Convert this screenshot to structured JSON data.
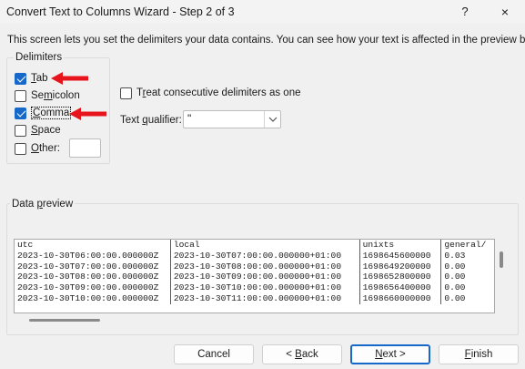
{
  "window": {
    "title": "Convert Text to Columns Wizard - Step 2 of 3",
    "help_label": "?",
    "close_label": "×"
  },
  "instructions": "This screen lets you set the delimiters your data contains.  You can see how your text is affected in the preview below.",
  "delimiters": {
    "legend": "Delimiters",
    "tab": {
      "pre": "",
      "key": "T",
      "post": "ab",
      "checked": true
    },
    "semicolon": {
      "pre": "Se",
      "key": "m",
      "post": "icolon",
      "checked": false
    },
    "comma": {
      "pre": "",
      "key": "C",
      "post": "omma",
      "checked": true
    },
    "space": {
      "pre": "",
      "key": "S",
      "post": "pace",
      "checked": false
    },
    "other": {
      "pre": "",
      "key": "O",
      "post": "ther:",
      "checked": false,
      "value": ""
    }
  },
  "consecutive": {
    "pre": "T",
    "key": "r",
    "post": "eat consecutive delimiters as one",
    "checked": false
  },
  "text_qualifier": {
    "pre": "Text ",
    "key": "q",
    "post": "ualifier:",
    "value": "\""
  },
  "preview": {
    "legend_pre": "Data ",
    "legend_key": "p",
    "legend_post": "review",
    "rows": [
      [
        "utc",
        "local",
        "unixts",
        "general/"
      ],
      [
        "2023-10-30T06:00:00.000000Z",
        "2023-10-30T07:00:00.000000+01:00",
        "1698645600000",
        "0.03"
      ],
      [
        "2023-10-30T07:00:00.000000Z",
        "2023-10-30T08:00:00.000000+01:00",
        "1698649200000",
        "0.00"
      ],
      [
        "2023-10-30T08:00:00.000000Z",
        "2023-10-30T09:00:00.000000+01:00",
        "1698652800000",
        "0.00"
      ],
      [
        "2023-10-30T09:00:00.000000Z",
        "2023-10-30T10:00:00.000000+01:00",
        "1698656400000",
        "0.00"
      ],
      [
        "2023-10-30T10:00:00.000000Z",
        "2023-10-30T11:00:00.000000+01:00",
        "1698660000000",
        "0.00"
      ]
    ]
  },
  "buttons": {
    "cancel": "Cancel",
    "back": {
      "pre": "< ",
      "key": "B",
      "post": "ack"
    },
    "next": {
      "pre": "",
      "key": "N",
      "post": "ext >"
    },
    "finish": {
      "pre": "",
      "key": "F",
      "post": "inish"
    }
  },
  "colors": {
    "accent": "#1668c9",
    "annotation_arrow": "#e8141b"
  },
  "icons": {
    "annotation": "red-arrow-icon",
    "dropdown": "chevron-down-icon"
  }
}
